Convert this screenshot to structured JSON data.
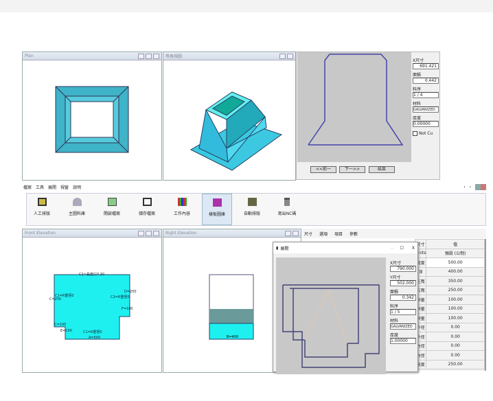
{
  "windows": {
    "plan": "Plan",
    "iso": "等角視圖",
    "front": "Front Elevation",
    "right": "Right Elevation",
    "unfold": "展開"
  },
  "top_dialog": {
    "fields": [
      {
        "label": "X尺寸",
        "value": "691.421"
      },
      {
        "label": "面積",
        "value": "0.442"
      },
      {
        "label": "料序",
        "value": "1 / 4"
      },
      {
        "label": "材料",
        "value": "GALVANIZED"
      },
      {
        "label": "厚度",
        "value": "0.00000"
      }
    ],
    "checkbox": "Not Cu",
    "prev": "<<前一",
    "next": "下一>>",
    "finish": "結束"
  },
  "menu": [
    "檔案",
    "工具",
    "展開",
    "視窗",
    "說明"
  ],
  "toolbar": [
    "人工排版",
    "主圖料庫",
    "開啟檔案",
    "儲存檔案",
    "工作內容",
    "樣板圖庫",
    "自動排版",
    "寫出NC碼"
  ],
  "tabs": [
    "尺寸",
    "選項",
    "項目",
    "參數"
  ],
  "front": {
    "labels": [
      "C1=長度口7.30",
      "C1=R重徑0",
      "C=250",
      "D=250",
      "C2=R重徑0",
      "F=100",
      "C=100",
      "E=100",
      "C1=R重徑0",
      "A=500"
    ]
  },
  "right": {
    "label": "B=400"
  },
  "bottom_dialog": {
    "fields": [
      {
        "label": "X尺寸",
        "value": "790.000"
      },
      {
        "label": "Y尺寸",
        "value": "502.000"
      },
      {
        "label": "面積",
        "value": "0.342"
      },
      {
        "label": "料序",
        "value": "1 / 5"
      },
      {
        "label": "材料",
        "value": "GALVANIZED"
      },
      {
        "label": "厚度",
        "value": "1.00000"
      }
    ]
  },
  "table": {
    "header": [
      "尺寸",
      "值"
    ],
    "units": [
      "Units",
      "預設 (公制)"
    ],
    "rows": [
      [
        "寬度",
        "500.00"
      ],
      [
        "深",
        "400.00"
      ],
      [
        "左寬",
        "350.00"
      ],
      [
        "右寬",
        "250.00"
      ],
      [
        "伸量",
        "100.00"
      ],
      [
        "伸量",
        "100.00"
      ],
      [
        "伸量",
        "100.00"
      ],
      [
        "外徑",
        "0.00"
      ],
      [
        "外徑",
        "0.00"
      ],
      [
        "內徑",
        "0.00"
      ],
      [
        "內徑",
        "0.00"
      ],
      [
        "高度",
        "250.00"
      ]
    ]
  }
}
